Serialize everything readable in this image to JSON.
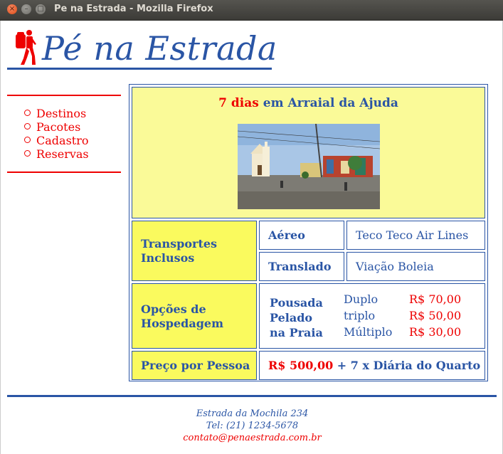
{
  "window": {
    "title": "Pe na Estrada - Mozilla Firefox",
    "close_glyph": "×",
    "min_glyph": "–",
    "max_glyph": "□"
  },
  "header": {
    "logo_icon": "backpacker-icon",
    "title": "Pé na Estrada"
  },
  "nav": {
    "items": [
      "Destinos",
      "Pacotes",
      "Cadastro",
      "Reservas"
    ]
  },
  "destination": {
    "days": "7 dias",
    "connector": " em ",
    "place": "Arraial da Ajuda"
  },
  "transport": {
    "label": "Transportes Inclusos",
    "rows": [
      {
        "type": "Aéreo",
        "provider": "Teco Teco Air Lines"
      },
      {
        "type": "Translado",
        "provider": "Viação Boleia"
      }
    ]
  },
  "lodging": {
    "label": "Opções de Hospedagem",
    "hotel_lines": [
      "Pousada",
      "Pelado",
      "na Praia"
    ],
    "rooms": [
      {
        "type": "Duplo",
        "price": "R$ 70,00"
      },
      {
        "type": "triplo",
        "price": "R$ 50,00"
      },
      {
        "type": "Múltiplo",
        "price": "R$ 30,00"
      }
    ]
  },
  "price": {
    "label": "Preço por Pessoa",
    "amount": "R$ 500,00",
    "suffix": " + 7 x Diária do Quarto"
  },
  "footer": {
    "address": "Estrada da Mochila 234",
    "phone": "Tel: (21) 1234-5678",
    "email": "contato@penaestrada.com.br"
  },
  "colors": {
    "brand_blue": "#2a55a5",
    "accent_red": "#ee0000",
    "header_yellow": "#fafa98",
    "label_yellow": "#fafa5e"
  }
}
